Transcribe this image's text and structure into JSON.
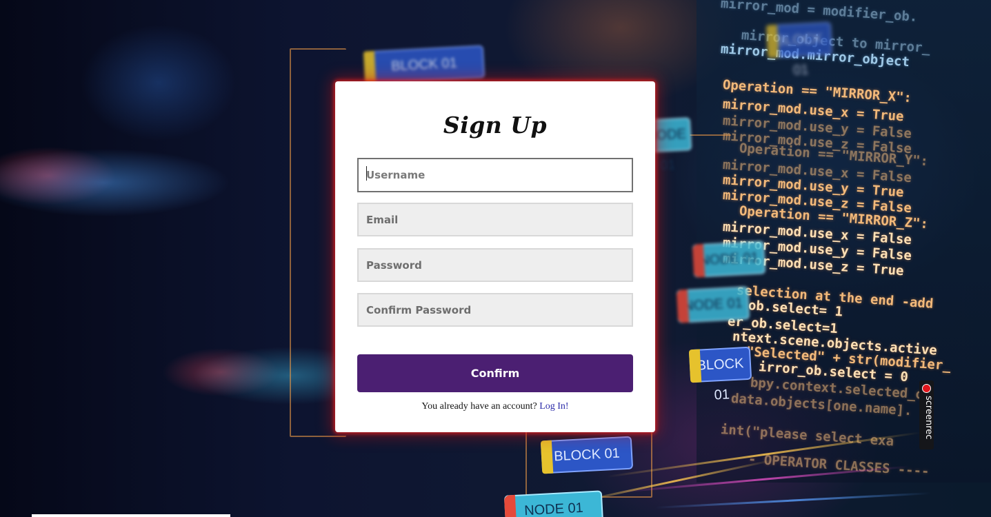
{
  "signup": {
    "title": "Sign Up",
    "fields": {
      "username": {
        "placeholder": "Username",
        "value": ""
      },
      "email": {
        "placeholder": "Email",
        "value": ""
      },
      "password": {
        "placeholder": "Password",
        "value": ""
      },
      "confirm_password": {
        "placeholder": "Confirm Password",
        "value": ""
      }
    },
    "confirm_label": "Confirm",
    "login_prompt": "You already have an account?",
    "login_link": "Log In!"
  },
  "background": {
    "code_lines": [
      "mirror_mod = modifier_ob.",
      "mirror_object to mirror_",
      "mirror_mod.mirror_object",
      "Operation == \"MIRROR_X\":",
      "mirror_mod.use_x = True",
      "mirror_mod.use_y = False",
      "mirror_mod.use_z = False",
      "Operation == \"MIRROR_Y\":",
      "mirror_mod.use_x = False",
      "mirror_mod.use_y = True",
      "mirror_mod.use_z = False",
      "Operation == \"MIRROR_Z\":",
      "mirror_mod.use_x = False",
      "mirror_mod.use_y = False",
      "mirror_mod.use_z = True",
      "selection at the end -add",
      "ob.select= 1",
      "er_ob.select=1",
      "ntext.scene.objects.active",
      "\"Selected\" + str(modifier_",
      "irror_ob.select = 0",
      "bpy.context.selected_ob",
      "data.objects[one.name].",
      "int(\"please select exa",
      "- OPERATOR CLASSES ----"
    ],
    "tags": [
      {
        "label": "BLOCK 01",
        "kind": "block"
      },
      {
        "label": "NODE 01",
        "kind": "node"
      },
      {
        "label": "NODE 01",
        "kind": "node"
      },
      {
        "label": "NODE 01",
        "kind": "node"
      },
      {
        "label": "BLOCK 01",
        "kind": "block"
      },
      {
        "label": "BLOCK 01",
        "kind": "block"
      },
      {
        "label": "NODE 01",
        "kind": "node"
      },
      {
        "label": "BLOCK 01",
        "kind": "block"
      }
    ]
  },
  "overlay": {
    "screenrec_label": "screenrec"
  }
}
